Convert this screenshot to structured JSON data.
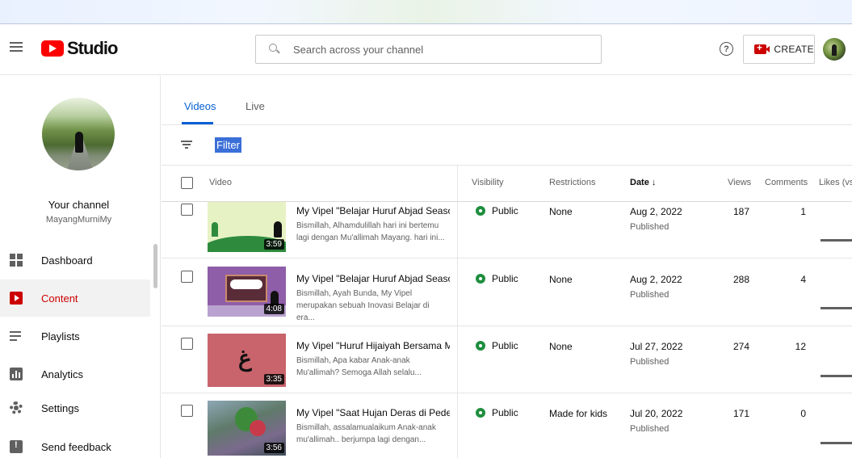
{
  "header": {
    "logo_text": "Studio",
    "search_placeholder": "Search across your channel",
    "create_label": "CREATE"
  },
  "sidebar": {
    "channel_title": "Your channel",
    "channel_handle": "MayangMurniMy",
    "items": [
      {
        "label": "Dashboard",
        "icon": "dashboard-icon"
      },
      {
        "label": "Content",
        "icon": "content-icon",
        "active": true
      },
      {
        "label": "Playlists",
        "icon": "playlists-icon"
      },
      {
        "label": "Analytics",
        "icon": "analytics-icon"
      },
      {
        "label": "Settings",
        "icon": "settings-icon"
      },
      {
        "label": "Send feedback",
        "icon": "feedback-icon"
      }
    ]
  },
  "tabs": [
    "Videos",
    "Live"
  ],
  "filter_label": "Filter",
  "table": {
    "columns": [
      "Video",
      "Visibility",
      "Restrictions",
      "Date ↓",
      "Views",
      "Comments",
      "Likes (vs"
    ],
    "rows": [
      {
        "title": "My Vipel \"Belajar Huruf Abjad Season ...",
        "desc1": "Bismillah, Alhamdulillah hari ini bertemu",
        "desc2": "lagi dengan Mu'allimah Mayang. hari ini...",
        "duration": "3:59",
        "visibility": "Public",
        "restrictions": "None",
        "date": "Aug 2, 2022",
        "date_status": "Published",
        "views": "187",
        "comments": "1"
      },
      {
        "title": "My Vipel \"Belajar Huruf Abjad Season ...",
        "desc1": "Bismillah, Ayah Bunda, My Vipel",
        "desc2": "merupakan sebuah Inovasi Belajar di era...",
        "duration": "4:08",
        "visibility": "Public",
        "restrictions": "None",
        "date": "Aug 2, 2022",
        "date_status": "Published",
        "views": "288",
        "comments": "4"
      },
      {
        "title": "My Vipel \"Huruf Hijaiyah Bersama Mu'...",
        "desc1": "Bismillah, Apa kabar Anak-anak",
        "desc2": "Mu'allimah? Semoga Allah selalu...",
        "duration": "3:35",
        "visibility": "Public",
        "restrictions": "None",
        "date": "Jul 27, 2022",
        "date_status": "Published",
        "views": "274",
        "comments": "12"
      },
      {
        "title": "My Vipel \"Saat Hujan Deras di Pedesa...",
        "desc1": "Bismillah, assalamualaikum Anak-anak",
        "desc2": "mu'allimah.. berjumpa lagi dengan...",
        "duration": "3:56",
        "visibility": "Public",
        "restrictions": "Made for kids",
        "date": "Jul 20, 2022",
        "date_status": "Published",
        "views": "171",
        "comments": "0"
      }
    ]
  },
  "colors": {
    "brand_red": "#ff0000",
    "active_red": "#cc0000",
    "tab_blue": "#065fd4",
    "public_green": "#1e8e3e"
  }
}
